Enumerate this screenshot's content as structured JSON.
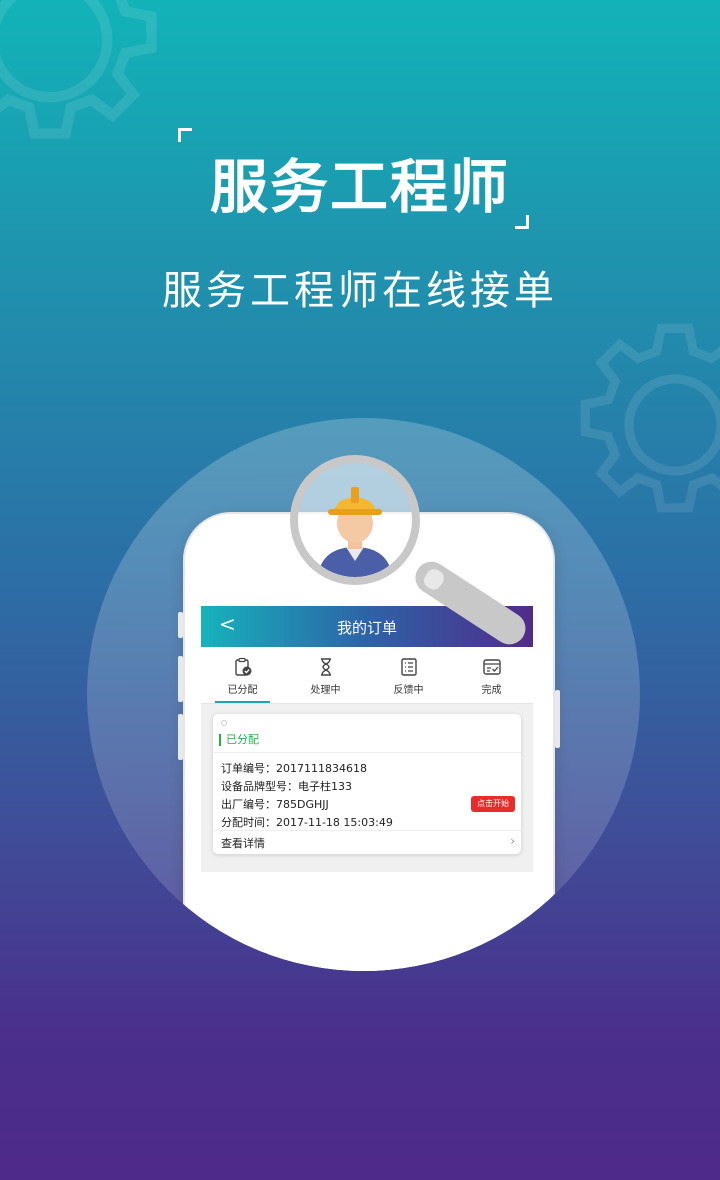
{
  "hero": {
    "title": "服务工程师",
    "subtitle": "服务工程师在线接单"
  },
  "app": {
    "back_label": "<",
    "title": "我的订单",
    "accent": "#16b3bc"
  },
  "tabs": [
    {
      "label": "已分配",
      "icon": "assigned-clipboard-icon",
      "active": true
    },
    {
      "label": "处理中",
      "icon": "hourglass-icon",
      "active": false
    },
    {
      "label": "反馈中",
      "icon": "feedback-list-icon",
      "active": false
    },
    {
      "label": "完成",
      "icon": "done-icon",
      "active": false
    }
  ],
  "order": {
    "status": "已分配",
    "status_color": "#22b24c",
    "rows": [
      {
        "key": "订单编号：",
        "value": "2017111834618"
      },
      {
        "key": "设备品牌型号：",
        "value": "电子柱133"
      },
      {
        "key": "出厂编号：",
        "value": "785DGHJJ"
      },
      {
        "key": "分配时间：",
        "value": "2017-11-18 15:03:49"
      }
    ],
    "start_button": "点击开始",
    "start_color": "#e82b2b",
    "details_label": "查看详情"
  }
}
